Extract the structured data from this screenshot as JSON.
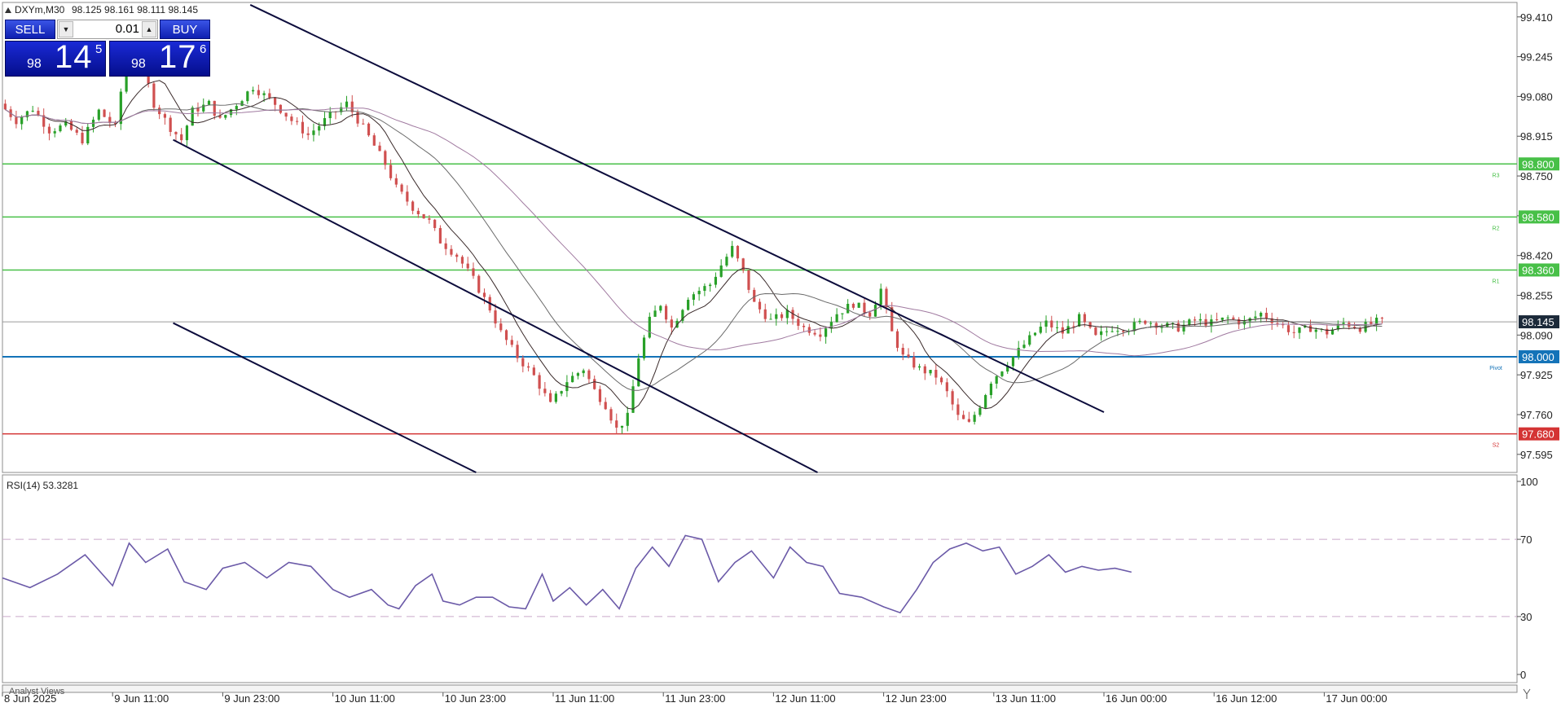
{
  "header": {
    "symbol_info": "DXYm,M30",
    "ohlc": "98.125 98.161 98.111 98.145"
  },
  "trade_panel": {
    "sell_label": "SELL",
    "buy_label": "BUY",
    "lot_value": "0.01",
    "sell_price": {
      "prefix": "98",
      "big": "14",
      "sup": "5"
    },
    "buy_price": {
      "prefix": "98",
      "big": "17",
      "sup": "6"
    }
  },
  "rsi": {
    "label": "RSI(14) 53.3281"
  },
  "analyst_views_label": "Analyst Views",
  "colors": {
    "resistance": "#48c048",
    "pivot": "#1473b8",
    "support": "#d43434",
    "channel": "#0c0c3c",
    "rsi_line": "#6b5aa8",
    "bull": "#28a028",
    "bear": "#d05050"
  },
  "chart_data": [
    {
      "type": "candlestick",
      "symbol": "DXYm",
      "timeframe": "M30",
      "ylim": [
        97.52,
        99.47
      ],
      "y_ticks": [
        "99.410",
        "99.245",
        "99.080",
        "98.915",
        "98.750",
        "98.585",
        "98.420",
        "98.255",
        "98.090",
        "97.925",
        "97.760",
        "97.595"
      ],
      "x_ticks": [
        "8 Jun 2025",
        "9 Jun 11:00",
        "9 Jun 23:00",
        "10 Jun 11:00",
        "10 Jun 23:00",
        "11 Jun 11:00",
        "11 Jun 23:00",
        "12 Jun 11:00",
        "12 Jun 23:00",
        "13 Jun 11:00",
        "16 Jun 00:00",
        "16 Jun 12:00",
        "17 Jun 00:00"
      ],
      "current_price": "98.145",
      "levels": [
        {
          "value": "98.800",
          "label": "R3",
          "kind": "resistance"
        },
        {
          "value": "98.580",
          "label": "R2",
          "kind": "resistance"
        },
        {
          "value": "98.360",
          "label": "R1",
          "kind": "resistance"
        },
        {
          "value": "98.000",
          "label": "Pivot",
          "kind": "pivot"
        },
        {
          "value": "97.680",
          "label": "S2",
          "kind": "support"
        }
      ],
      "channel_lines": [
        {
          "from": [
            4.5,
            99.46
          ],
          "to": [
            20.0,
            97.77
          ]
        },
        {
          "from": [
            3.1,
            98.9
          ],
          "to": [
            14.8,
            97.52
          ]
        },
        {
          "from": [
            3.1,
            98.14
          ],
          "to": [
            8.6,
            97.52
          ]
        }
      ],
      "price_path": [
        [
          0.0,
          99.05
        ],
        [
          0.3,
          98.98
        ],
        [
          0.6,
          99.03
        ],
        [
          0.9,
          98.94
        ],
        [
          1.2,
          98.96
        ],
        [
          1.5,
          98.9
        ],
        [
          1.8,
          99.02
        ],
        [
          2.1,
          98.95
        ],
        [
          2.3,
          99.25
        ],
        [
          2.6,
          99.2
        ],
        [
          2.8,
          99.05
        ],
        [
          3.1,
          98.95
        ],
        [
          3.3,
          98.9
        ],
        [
          3.5,
          99.02
        ],
        [
          3.8,
          99.05
        ],
        [
          4.0,
          98.98
        ],
        [
          4.3,
          99.05
        ],
        [
          4.6,
          99.12
        ],
        [
          5.0,
          99.05
        ],
        [
          5.3,
          98.98
        ],
        [
          5.6,
          98.92
        ],
        [
          6.0,
          99.0
        ],
        [
          6.3,
          99.05
        ],
        [
          6.6,
          98.95
        ],
        [
          7.0,
          98.8
        ],
        [
          7.2,
          98.7
        ],
        [
          7.5,
          98.62
        ],
        [
          7.8,
          98.56
        ],
        [
          8.0,
          98.48
        ],
        [
          8.3,
          98.42
        ],
        [
          8.6,
          98.32
        ],
        [
          8.9,
          98.2
        ],
        [
          9.1,
          98.1
        ],
        [
          9.4,
          98.0
        ],
        [
          9.7,
          97.92
        ],
        [
          10.0,
          97.8
        ],
        [
          10.3,
          97.9
        ],
        [
          10.6,
          97.95
        ],
        [
          10.8,
          97.86
        ],
        [
          11.0,
          97.8
        ],
        [
          11.2,
          97.7
        ],
        [
          11.4,
          97.75
        ],
        [
          11.6,
          98.0
        ],
        [
          11.8,
          98.15
        ],
        [
          12.0,
          98.22
        ],
        [
          12.2,
          98.12
        ],
        [
          12.5,
          98.25
        ],
        [
          12.9,
          98.3
        ],
        [
          13.1,
          98.38
        ],
        [
          13.3,
          98.45
        ],
        [
          13.5,
          98.35
        ],
        [
          13.7,
          98.22
        ],
        [
          14.0,
          98.15
        ],
        [
          14.3,
          98.18
        ],
        [
          14.6,
          98.12
        ],
        [
          14.9,
          98.1
        ],
        [
          15.2,
          98.18
        ],
        [
          15.5,
          98.22
        ],
        [
          15.8,
          98.18
        ],
        [
          16.0,
          98.28
        ],
        [
          16.2,
          98.1
        ],
        [
          16.4,
          98.0
        ],
        [
          16.7,
          97.95
        ],
        [
          17.0,
          97.92
        ],
        [
          17.2,
          97.85
        ],
        [
          17.4,
          97.75
        ],
        [
          17.6,
          97.72
        ],
        [
          17.8,
          97.8
        ],
        [
          18.0,
          97.9
        ],
        [
          18.2,
          97.95
        ],
        [
          18.4,
          98.0
        ],
        [
          18.6,
          98.05
        ],
        [
          18.8,
          98.1
        ],
        [
          19.0,
          98.14
        ],
        [
          19.3,
          98.1
        ],
        [
          19.6,
          98.16
        ],
        [
          19.9,
          98.08
        ],
        [
          20.2,
          98.12
        ],
        [
          20.5,
          98.12
        ],
        [
          20.8,
          98.15
        ],
        [
          21.1,
          98.13
        ],
        [
          21.4,
          98.12
        ],
        [
          21.7,
          98.15
        ],
        [
          22.0,
          98.14
        ],
        [
          22.3,
          98.16
        ],
        [
          22.6,
          98.14
        ],
        [
          22.9,
          98.18
        ],
        [
          23.2,
          98.14
        ],
        [
          23.5,
          98.1
        ],
        [
          23.8,
          98.12
        ],
        [
          24.1,
          98.1
        ],
        [
          24.4,
          98.14
        ],
        [
          24.7,
          98.12
        ],
        [
          25.0,
          98.145
        ]
      ]
    },
    {
      "type": "line",
      "indicator": "RSI",
      "ylim": [
        0,
        100
      ],
      "y_ticks": [
        "100",
        "70",
        "30",
        "0"
      ],
      "levels": [
        70,
        30
      ],
      "x": [
        0.0,
        0.5,
        1.0,
        1.5,
        2.0,
        2.3,
        2.6,
        3.0,
        3.3,
        3.7,
        4.0,
        4.4,
        4.8,
        5.2,
        5.6,
        6.0,
        6.3,
        6.7,
        7.0,
        7.2,
        7.5,
        7.8,
        8.0,
        8.3,
        8.6,
        8.9,
        9.2,
        9.5,
        9.8,
        10.0,
        10.3,
        10.6,
        10.9,
        11.2,
        11.5,
        11.8,
        12.1,
        12.4,
        12.7,
        13.0,
        13.3,
        13.6,
        14.0,
        14.3,
        14.6,
        14.9,
        15.2,
        15.6,
        16.0,
        16.3,
        16.6,
        16.9,
        17.2,
        17.5,
        17.8,
        18.1,
        18.4,
        18.7,
        19.0,
        19.3,
        19.6,
        19.9,
        20.2,
        20.5
      ],
      "values": [
        50,
        45,
        52,
        62,
        46,
        68,
        58,
        65,
        48,
        44,
        55,
        58,
        50,
        58,
        56,
        44,
        40,
        44,
        36,
        34,
        46,
        52,
        38,
        36,
        40,
        40,
        35,
        34,
        52,
        38,
        45,
        36,
        44,
        34,
        55,
        66,
        56,
        72,
        70,
        48,
        58,
        64,
        50,
        66,
        58,
        56,
        42,
        40,
        35,
        32,
        44,
        58,
        65,
        68,
        64,
        66,
        52,
        56,
        62,
        53,
        56,
        54,
        55,
        53
      ]
    }
  ]
}
